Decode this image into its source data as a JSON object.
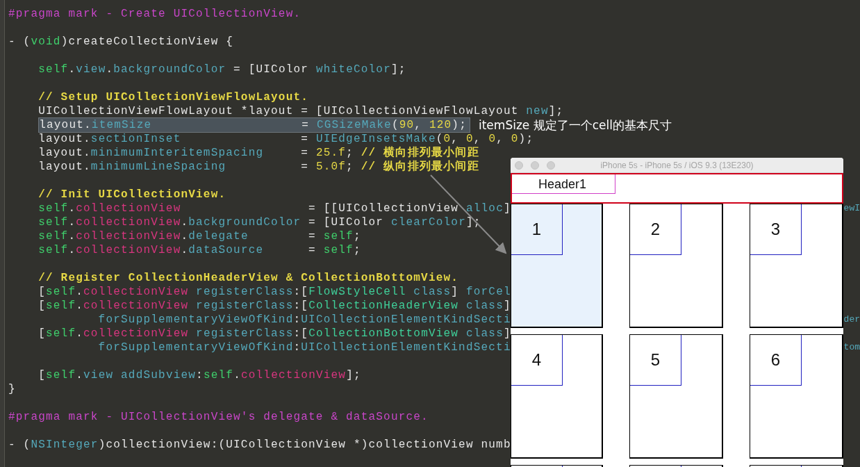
{
  "editor": {
    "lines": [
      {
        "kind": "code",
        "tokens": [
          {
            "kind": "macro",
            "text": "#pragma mark - Create UICollectionView."
          }
        ]
      },
      {
        "kind": "blank"
      },
      {
        "kind": "code",
        "tokens": [
          {
            "kind": "plain",
            "text": "- ("
          },
          {
            "kind": "keyword",
            "text": "void"
          },
          {
            "kind": "plain",
            "text": ")createCollectionView {"
          }
        ]
      },
      {
        "kind": "blank"
      },
      {
        "kind": "code",
        "tokens": [
          {
            "kind": "keyword",
            "text": "    self"
          },
          {
            "kind": "plain",
            "text": "."
          },
          {
            "kind": "property",
            "text": "view"
          },
          {
            "kind": "plain",
            "text": "."
          },
          {
            "kind": "property",
            "text": "backgroundColor"
          },
          {
            "kind": "plain",
            "text": " = [UIColor "
          },
          {
            "kind": "property",
            "text": "whiteColor"
          },
          {
            "kind": "plain",
            "text": "];"
          }
        ]
      },
      {
        "kind": "blank"
      },
      {
        "kind": "code",
        "tokens": [
          {
            "kind": "comment",
            "text": "    // Setup UICollectionViewFlowLayout."
          }
        ]
      },
      {
        "kind": "code",
        "tokens": [
          {
            "kind": "plain",
            "text": "    UICollectionViewFlowLayout *layout = [UICollectionViewFlowLayout "
          },
          {
            "kind": "property",
            "text": "new"
          },
          {
            "kind": "plain",
            "text": "];"
          }
        ]
      },
      {
        "kind": "code",
        "highlighted": true,
        "annotation": "itemSize 规定了一个cell的基本尺寸",
        "tokens": [
          {
            "kind": "plain",
            "text": "    layout."
          },
          {
            "kind": "property",
            "text": "itemSize"
          },
          {
            "kind": "plain",
            "text": "                    = "
          },
          {
            "kind": "property",
            "text": "CGSizeMake"
          },
          {
            "kind": "plain",
            "text": "("
          },
          {
            "kind": "number",
            "text": "90"
          },
          {
            "kind": "plain",
            "text": ", "
          },
          {
            "kind": "number",
            "text": "120"
          },
          {
            "kind": "plain",
            "text": ");"
          }
        ]
      },
      {
        "kind": "code",
        "tokens": [
          {
            "kind": "plain",
            "text": "    layout."
          },
          {
            "kind": "property",
            "text": "sectionInset"
          },
          {
            "kind": "plain",
            "text": "                = "
          },
          {
            "kind": "property",
            "text": "UIEdgeInsetsMake"
          },
          {
            "kind": "plain",
            "text": "("
          },
          {
            "kind": "number",
            "text": "0"
          },
          {
            "kind": "plain",
            "text": ", "
          },
          {
            "kind": "number",
            "text": "0"
          },
          {
            "kind": "plain",
            "text": ", "
          },
          {
            "kind": "number",
            "text": "0"
          },
          {
            "kind": "plain",
            "text": ", "
          },
          {
            "kind": "number",
            "text": "0"
          },
          {
            "kind": "plain",
            "text": ");"
          }
        ]
      },
      {
        "kind": "code",
        "tokens": [
          {
            "kind": "plain",
            "text": "    layout."
          },
          {
            "kind": "property",
            "text": "minimumInteritemSpacing"
          },
          {
            "kind": "plain",
            "text": "     = "
          },
          {
            "kind": "number",
            "text": "25.f"
          },
          {
            "kind": "plain",
            "text": "; "
          },
          {
            "kind": "comment",
            "text": "// 横向排列最小间距"
          }
        ]
      },
      {
        "kind": "code",
        "tokens": [
          {
            "kind": "plain",
            "text": "    layout."
          },
          {
            "kind": "property",
            "text": "minimumLineSpacing"
          },
          {
            "kind": "plain",
            "text": "          = "
          },
          {
            "kind": "number",
            "text": "5.0f"
          },
          {
            "kind": "plain",
            "text": "; "
          },
          {
            "kind": "comment",
            "text": "// 纵向排列最小间距"
          }
        ]
      },
      {
        "kind": "blank"
      },
      {
        "kind": "code",
        "tokens": [
          {
            "kind": "comment",
            "text": "    // Init UICollectionView."
          }
        ]
      },
      {
        "kind": "code",
        "tail": "ewI",
        "tokens": [
          {
            "kind": "keyword",
            "text": "    self"
          },
          {
            "kind": "plain",
            "text": "."
          },
          {
            "kind": "ivar",
            "text": "collectionView"
          },
          {
            "kind": "plain",
            "text": "                 = [[UICollectionView "
          },
          {
            "kind": "property",
            "text": "alloc"
          },
          {
            "kind": "plain",
            "text": "]"
          }
        ]
      },
      {
        "kind": "code",
        "tokens": [
          {
            "kind": "keyword",
            "text": "    self"
          },
          {
            "kind": "plain",
            "text": "."
          },
          {
            "kind": "ivar",
            "text": "collectionView"
          },
          {
            "kind": "plain",
            "text": "."
          },
          {
            "kind": "property",
            "text": "backgroundColor"
          },
          {
            "kind": "plain",
            "text": " = [UIColor "
          },
          {
            "kind": "property",
            "text": "clearColor"
          },
          {
            "kind": "plain",
            "text": "];"
          }
        ]
      },
      {
        "kind": "code",
        "tokens": [
          {
            "kind": "keyword",
            "text": "    self"
          },
          {
            "kind": "plain",
            "text": "."
          },
          {
            "kind": "ivar",
            "text": "collectionView"
          },
          {
            "kind": "plain",
            "text": "."
          },
          {
            "kind": "property",
            "text": "delegate"
          },
          {
            "kind": "plain",
            "text": "        = "
          },
          {
            "kind": "keyword",
            "text": "self"
          },
          {
            "kind": "plain",
            "text": ";"
          }
        ]
      },
      {
        "kind": "code",
        "tokens": [
          {
            "kind": "keyword",
            "text": "    self"
          },
          {
            "kind": "plain",
            "text": "."
          },
          {
            "kind": "ivar",
            "text": "collectionView"
          },
          {
            "kind": "plain",
            "text": "."
          },
          {
            "kind": "property",
            "text": "dataSource"
          },
          {
            "kind": "plain",
            "text": "      = "
          },
          {
            "kind": "keyword",
            "text": "self"
          },
          {
            "kind": "plain",
            "text": ";"
          }
        ]
      },
      {
        "kind": "blank"
      },
      {
        "kind": "code",
        "tokens": [
          {
            "kind": "comment",
            "text": "    // Register CollectionHeaderView & CollectionBottomView."
          }
        ]
      },
      {
        "kind": "code",
        "tokens": [
          {
            "kind": "plain",
            "text": "    ["
          },
          {
            "kind": "keyword",
            "text": "self"
          },
          {
            "kind": "plain",
            "text": "."
          },
          {
            "kind": "ivar",
            "text": "collectionView"
          },
          {
            "kind": "property",
            "text": " registerClass"
          },
          {
            "kind": "plain",
            "text": ":["
          },
          {
            "kind": "class",
            "text": "FlowStyleCell"
          },
          {
            "kind": "property",
            "text": " class"
          },
          {
            "kind": "plain",
            "text": "] "
          },
          {
            "kind": "property",
            "text": "forCel"
          }
        ]
      },
      {
        "kind": "code",
        "tokens": [
          {
            "kind": "plain",
            "text": "    ["
          },
          {
            "kind": "keyword",
            "text": "self"
          },
          {
            "kind": "plain",
            "text": "."
          },
          {
            "kind": "ivar",
            "text": "collectionView"
          },
          {
            "kind": "property",
            "text": " registerClass"
          },
          {
            "kind": "plain",
            "text": ":["
          },
          {
            "kind": "class",
            "text": "CollectionHeaderView"
          },
          {
            "kind": "property",
            "text": " class"
          },
          {
            "kind": "plain",
            "text": "]"
          }
        ]
      },
      {
        "kind": "code",
        "tail": "der",
        "tokens": [
          {
            "kind": "property",
            "text": "            forSupplementaryViewOfKind"
          },
          {
            "kind": "plain",
            "text": ":"
          },
          {
            "kind": "property",
            "text": "UICollectionElementKindSecti"
          }
        ]
      },
      {
        "kind": "code",
        "tokens": [
          {
            "kind": "plain",
            "text": "    ["
          },
          {
            "kind": "keyword",
            "text": "self"
          },
          {
            "kind": "plain",
            "text": "."
          },
          {
            "kind": "ivar",
            "text": "collectionView"
          },
          {
            "kind": "property",
            "text": " registerClass"
          },
          {
            "kind": "plain",
            "text": ":["
          },
          {
            "kind": "class",
            "text": "CollectionBottomView"
          },
          {
            "kind": "property",
            "text": " class"
          },
          {
            "kind": "plain",
            "text": "]"
          }
        ]
      },
      {
        "kind": "code",
        "tail": "tom",
        "tokens": [
          {
            "kind": "property",
            "text": "            forSupplementaryViewOfKind"
          },
          {
            "kind": "plain",
            "text": ":"
          },
          {
            "kind": "property",
            "text": "UICollectionElementKindSecti"
          }
        ]
      },
      {
        "kind": "blank"
      },
      {
        "kind": "code",
        "tokens": [
          {
            "kind": "plain",
            "text": "    ["
          },
          {
            "kind": "keyword",
            "text": "self"
          },
          {
            "kind": "plain",
            "text": "."
          },
          {
            "kind": "property",
            "text": "view"
          },
          {
            "kind": "property",
            "text": " addSubview"
          },
          {
            "kind": "plain",
            "text": ":"
          },
          {
            "kind": "keyword",
            "text": "self"
          },
          {
            "kind": "plain",
            "text": "."
          },
          {
            "kind": "ivar",
            "text": "collectionView"
          },
          {
            "kind": "plain",
            "text": "];"
          }
        ]
      },
      {
        "kind": "code",
        "tokens": [
          {
            "kind": "plain",
            "text": "}"
          }
        ]
      },
      {
        "kind": "blank"
      },
      {
        "kind": "code",
        "tokens": [
          {
            "kind": "macro",
            "text": "#pragma mark - UICollectionView's delegate & dataSource."
          }
        ]
      },
      {
        "kind": "blank"
      },
      {
        "kind": "code",
        "tokens": [
          {
            "kind": "plain",
            "text": "- ("
          },
          {
            "kind": "property",
            "text": "NSInteger"
          },
          {
            "kind": "plain",
            "text": ")collectionView:(UICollectionView *)collectionView numb"
          }
        ]
      }
    ]
  },
  "simulator": {
    "title": "iPhone 5s - iPhone 5s / iOS 9.3 (13E230)",
    "header": "Header1",
    "cells": [
      {
        "label": "1",
        "selected": true
      },
      {
        "label": "2",
        "selected": false
      },
      {
        "label": "3",
        "selected": false
      },
      {
        "label": "4",
        "selected": false
      },
      {
        "label": "5",
        "selected": false
      },
      {
        "label": "6",
        "selected": false
      },
      {
        "selected": false
      },
      {
        "selected": false
      },
      {
        "selected": false
      }
    ]
  }
}
